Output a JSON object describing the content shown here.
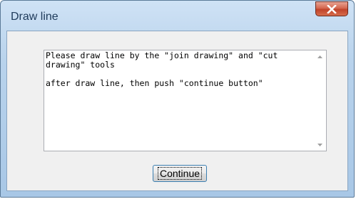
{
  "window": {
    "title": "Draw line"
  },
  "message": {
    "line1": "Please draw line by the \"join drawing\" and \"cut drawing\" tools",
    "line2": "after draw line, then push \"continue button\""
  },
  "buttons": {
    "continue_label": "Continue"
  },
  "icons": {
    "close": "close-icon",
    "scroll_up": "scroll-up-arrow-icon",
    "scroll_down": "scroll-down-arrow-icon"
  },
  "colors": {
    "title_bar": "#b9d3ec",
    "close_button": "#c0432a",
    "dialog_background": "#f0f0f0",
    "button_border": "#3c7fb1"
  }
}
